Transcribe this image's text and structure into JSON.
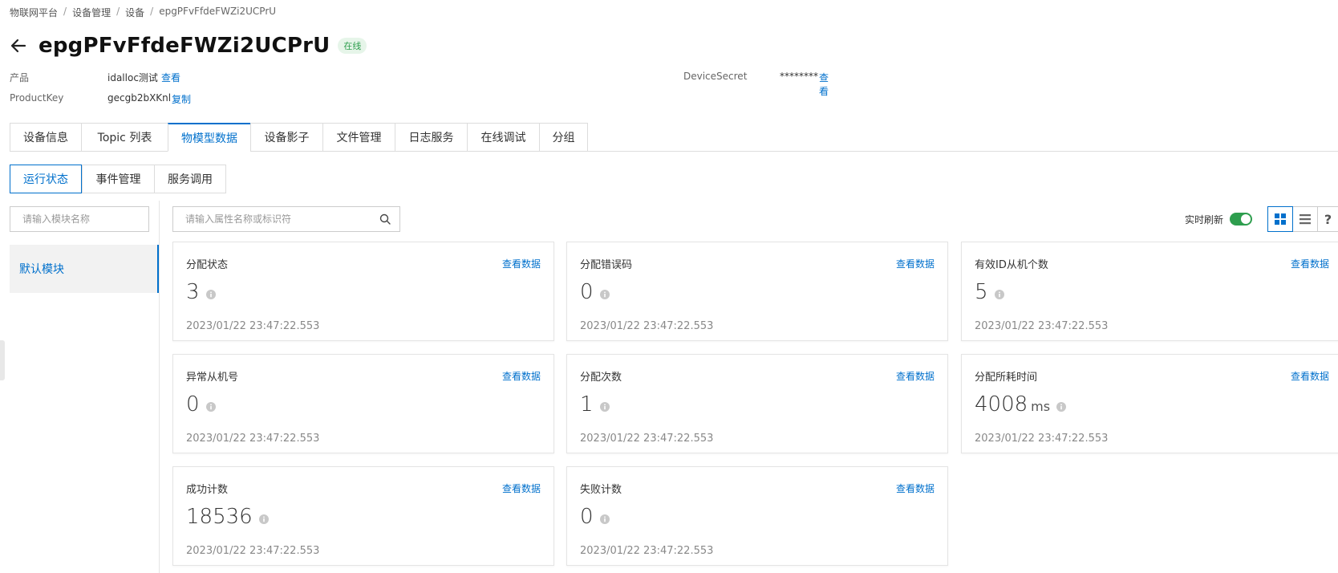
{
  "breadcrumb": [
    "物联网平台",
    "设备管理",
    "设备",
    "epgPFvFfdeFWZi2UCPrU"
  ],
  "header": {
    "title": "epgPFvFfdeFWZi2UCPrU",
    "status": "在线"
  },
  "meta": {
    "product_label": "产品",
    "product_value": "idalloc测试",
    "product_action": "查看",
    "productkey_label": "ProductKey",
    "productkey_value": "gecgb2bXKnl",
    "productkey_action": "复制",
    "secret_label": "DeviceSecret",
    "secret_value": "********",
    "secret_action": "查看"
  },
  "tabs": [
    "设备信息",
    "Topic 列表",
    "物模型数据",
    "设备影子",
    "文件管理",
    "日志服务",
    "在线调试",
    "分组"
  ],
  "active_tab": "物模型数据",
  "subtabs": [
    "运行状态",
    "事件管理",
    "服务调用"
  ],
  "active_subtab": "运行状态",
  "module_search": {
    "placeholder": "请输入模块名称"
  },
  "property_search": {
    "placeholder": "请输入属性名称或标识符"
  },
  "modules": [
    "默认模块"
  ],
  "toolbar": {
    "realtime_label": "实时刷新",
    "realtime_on": true,
    "help": "?"
  },
  "cards": [
    {
      "title": "分配状态",
      "value": "3",
      "unit": "",
      "time": "2023/01/22 23:47:22.553",
      "link": "查看数据"
    },
    {
      "title": "分配错误码",
      "value": "0",
      "unit": "",
      "time": "2023/01/22 23:47:22.553",
      "link": "查看数据"
    },
    {
      "title": "有效ID从机个数",
      "value": "5",
      "unit": "",
      "time": "2023/01/22 23:47:22.553",
      "link": "查看数据"
    },
    {
      "title": "异常从机号",
      "value": "0",
      "unit": "",
      "time": "2023/01/22 23:47:22.553",
      "link": "查看数据"
    },
    {
      "title": "分配次数",
      "value": "1",
      "unit": "",
      "time": "2023/01/22 23:47:22.553",
      "link": "查看数据"
    },
    {
      "title": "分配所耗时间",
      "value": "4008",
      "unit": "ms",
      "time": "2023/01/22 23:47:22.553",
      "link": "查看数据"
    },
    {
      "title": "成功计数",
      "value": "18536",
      "unit": "",
      "time": "2023/01/22 23:47:22.553",
      "link": "查看数据"
    },
    {
      "title": "失败计数",
      "value": "0",
      "unit": "",
      "time": "2023/01/22 23:47:22.553",
      "link": "查看数据"
    }
  ],
  "colors": {
    "accent": "#0070cc",
    "online": "#2e9e4e",
    "online_bg": "#e6f5e9"
  }
}
